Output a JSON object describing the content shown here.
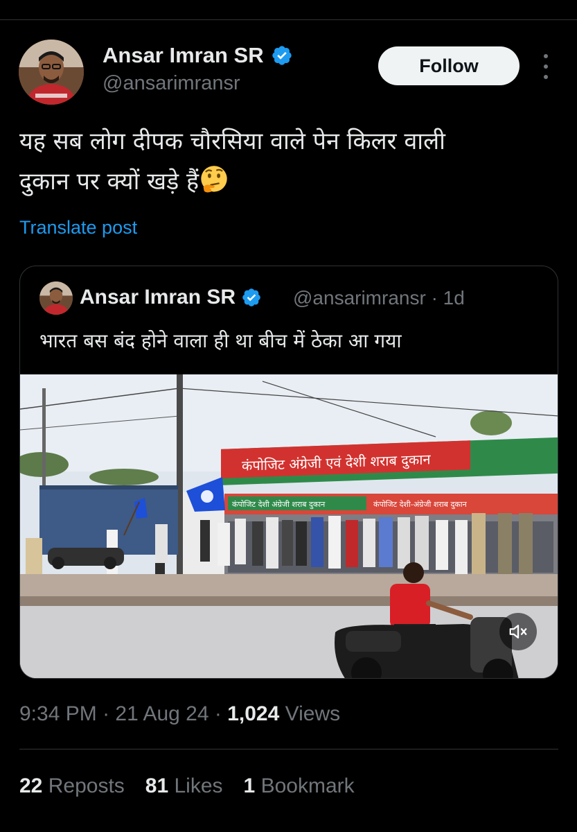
{
  "author": {
    "name": "Ansar Imran SR",
    "handle": "@ansarimransr"
  },
  "follow_label": "Follow",
  "post_text_line1": "यह सब लोग दीपक चौरसिया वाले पेन किलर वाली",
  "post_text_line2": "दुकान पर क्यों खड़े हैं",
  "translate_label": "Translate post",
  "quote": {
    "name": "Ansar Imran SR",
    "handle_time": "@ansarimransr · 1d",
    "text": "भारत बस बंद होने वाला ही था बीच में ठेका आ गया",
    "media": {
      "sign_top": "कंपोजिट अंग्रेजी एवं देशी शराब दुकान",
      "sign_bottom_left": "कंपोजिट देशी अंग्रेजी शराब दुकान",
      "sign_bottom_right": "कंपोजिट देशी-अंग्रेजी शराब दुकान"
    }
  },
  "meta": {
    "time": "9:34 PM",
    "date": "21 Aug 24",
    "views_count": "1,024",
    "views_label": "Views"
  },
  "stats": {
    "reposts_count": "22",
    "reposts_label": "Reposts",
    "likes_count": "81",
    "likes_label": "Likes",
    "bookmarks_count": "1",
    "bookmarks_label": "Bookmark"
  },
  "colors": {
    "background": "#000000",
    "text_primary": "#e7e9ea",
    "text_secondary": "#71767b",
    "link": "#1d9bf0",
    "border": "#2f3336",
    "verified": "#1d9bf0"
  }
}
